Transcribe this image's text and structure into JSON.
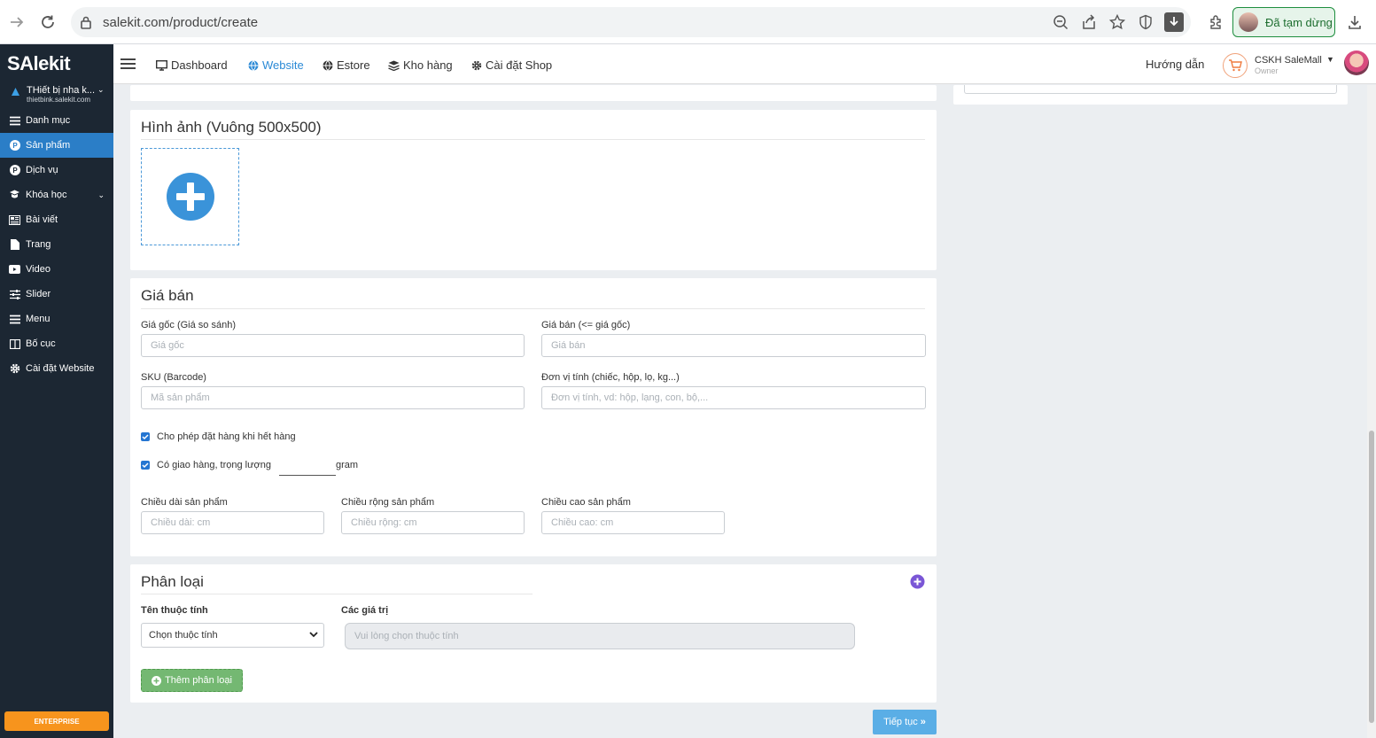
{
  "browser": {
    "url": "salekit.com/product/create",
    "profile_status": "Đã tạm dừng"
  },
  "sidebar": {
    "logo": "SAlekit",
    "shop_name": "THiết bị nha k...",
    "shop_domain": "thietbink.salekit.com",
    "items": [
      {
        "label": "Danh mục"
      },
      {
        "label": "Sản phẩm"
      },
      {
        "label": "Dịch vụ"
      },
      {
        "label": "Khóa học"
      },
      {
        "label": "Bài viết"
      },
      {
        "label": "Trang"
      },
      {
        "label": "Video"
      },
      {
        "label": "Slider"
      },
      {
        "label": "Menu"
      },
      {
        "label": "Bố cục"
      },
      {
        "label": "Cài đặt Website"
      }
    ],
    "plan": "ENTERPRISE"
  },
  "topnav": {
    "items": [
      {
        "label": "Dashboard"
      },
      {
        "label": "Website"
      },
      {
        "label": "Estore"
      },
      {
        "label": "Kho hàng"
      },
      {
        "label": "Cài đặt Shop"
      }
    ],
    "guide": "Hướng dẫn",
    "user_name": "CSKH SaleMall",
    "user_role": "Owner"
  },
  "images_section": {
    "title": "Hình ảnh (Vuông 500x500)"
  },
  "price_section": {
    "title": "Giá bán",
    "original_label": "Giá gốc (Giá so sánh)",
    "original_placeholder": "Giá gốc",
    "sale_label": "Giá bán (<= giá gốc)",
    "sale_placeholder": "Giá bán",
    "sku_label": "SKU (Barcode)",
    "sku_placeholder": "Mã sản phẩm",
    "unit_label": "Đơn vị tính (chiếc, hộp, lọ, kg...)",
    "unit_placeholder": "Đơn vị tính, vd: hộp, lạng, con, bộ,...",
    "allow_backorder": "Cho phép đặt hàng khi hết hàng",
    "shipping_label": "Có giao hàng, trọng lượng",
    "weight_unit": "gram",
    "length_label": "Chiều dài sản phẩm",
    "length_placeholder": "Chiều dài: cm",
    "width_label": "Chiều rộng sản phẩm",
    "width_placeholder": "Chiều rộng: cm",
    "height_label": "Chiều cao sản phẩm",
    "height_placeholder": "Chiều cao: cm"
  },
  "variant_section": {
    "title": "Phân loại",
    "attr_label": "Tên thuộc tính",
    "attr_select": "Chọn thuộc tính",
    "values_label": "Các giá trị",
    "values_placeholder": "Vui lòng chọn thuộc tính",
    "add_button": "Thêm phân loại"
  },
  "next_button": "Tiếp tục"
}
